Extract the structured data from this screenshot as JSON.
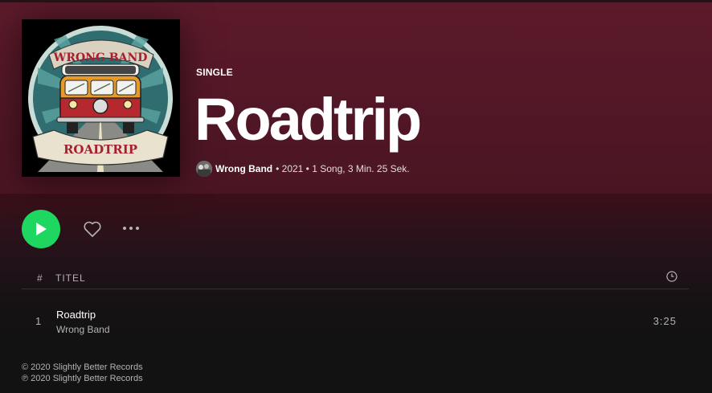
{
  "album": {
    "type_label": "SINGLE",
    "title": "Roadtrip",
    "artist": "Wrong Band",
    "meta_rest": "• 2021 • 1 Song, 3 Min. 25 Sek.",
    "cover_text_top": "WRONG BAND",
    "cover_text_bottom": "ROADTRIP"
  },
  "actions": {
    "play_icon": "play-icon",
    "like_icon": "heart-icon",
    "more_icon": "more-icon"
  },
  "table": {
    "header_num": "#",
    "header_title": "TITEL",
    "header_duration_icon": "clock-icon"
  },
  "tracks": [
    {
      "num": "1",
      "title": "Roadtrip",
      "artist": "Wrong Band",
      "duration": "3:25"
    }
  ],
  "copyright": {
    "c_line": "© 2020 Slightly Better Records",
    "p_line": "℗ 2020 Slightly Better Records"
  },
  "colors": {
    "hero": "#5c1a2a",
    "play_button": "#1ed760",
    "background": "#121212"
  }
}
